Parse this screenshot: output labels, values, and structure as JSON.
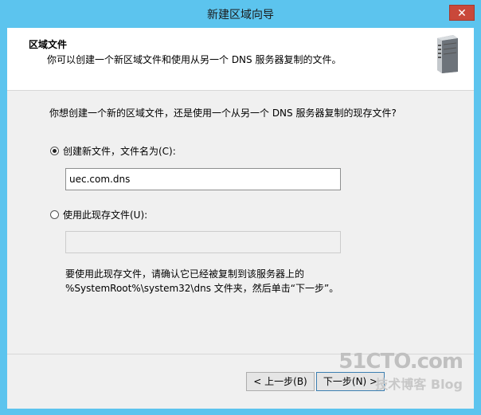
{
  "window": {
    "title": "新建区域向导",
    "close_label": "✕"
  },
  "header": {
    "title": "区域文件",
    "subtitle": "你可以创建一个新区域文件和使用从另一个 DNS 服务器复制的文件。",
    "icon": "server-icon"
  },
  "body": {
    "question": "你想创建一个新的区域文件，还是使用一个从另一个 DNS 服务器复制的现存文件?",
    "option_new": {
      "label": "创建新文件，文件名为(C):",
      "selected": true,
      "value": "uec.com.dns"
    },
    "option_existing": {
      "label": "使用此现存文件(U):",
      "selected": false,
      "value": ""
    },
    "note_line1": "要使用此现存文件，请确认它已经被复制到该服务器上的",
    "note_line2": "%SystemRoot%\\system32\\dns 文件夹，然后单击“下一步”。"
  },
  "buttons": {
    "back": "< 上一步(B)",
    "next": "下一步(N) >"
  },
  "watermark": {
    "line1": "51CTO.com",
    "line2": "技术博客 Blog"
  }
}
